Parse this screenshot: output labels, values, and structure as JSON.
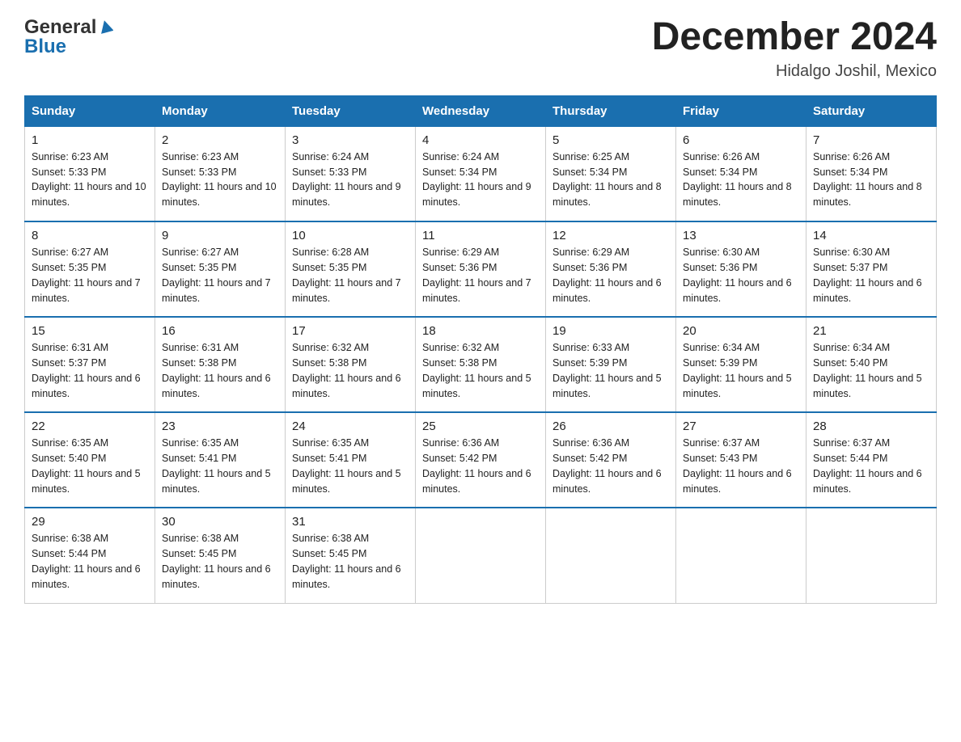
{
  "header": {
    "logo_general": "General",
    "logo_blue": "Blue",
    "main_title": "December 2024",
    "subtitle": "Hidalgo Joshil, Mexico"
  },
  "columns": [
    "Sunday",
    "Monday",
    "Tuesday",
    "Wednesday",
    "Thursday",
    "Friday",
    "Saturday"
  ],
  "weeks": [
    [
      {
        "day": "1",
        "sunrise": "Sunrise: 6:23 AM",
        "sunset": "Sunset: 5:33 PM",
        "daylight": "Daylight: 11 hours and 10 minutes."
      },
      {
        "day": "2",
        "sunrise": "Sunrise: 6:23 AM",
        "sunset": "Sunset: 5:33 PM",
        "daylight": "Daylight: 11 hours and 10 minutes."
      },
      {
        "day": "3",
        "sunrise": "Sunrise: 6:24 AM",
        "sunset": "Sunset: 5:33 PM",
        "daylight": "Daylight: 11 hours and 9 minutes."
      },
      {
        "day": "4",
        "sunrise": "Sunrise: 6:24 AM",
        "sunset": "Sunset: 5:34 PM",
        "daylight": "Daylight: 11 hours and 9 minutes."
      },
      {
        "day": "5",
        "sunrise": "Sunrise: 6:25 AM",
        "sunset": "Sunset: 5:34 PM",
        "daylight": "Daylight: 11 hours and 8 minutes."
      },
      {
        "day": "6",
        "sunrise": "Sunrise: 6:26 AM",
        "sunset": "Sunset: 5:34 PM",
        "daylight": "Daylight: 11 hours and 8 minutes."
      },
      {
        "day": "7",
        "sunrise": "Sunrise: 6:26 AM",
        "sunset": "Sunset: 5:34 PM",
        "daylight": "Daylight: 11 hours and 8 minutes."
      }
    ],
    [
      {
        "day": "8",
        "sunrise": "Sunrise: 6:27 AM",
        "sunset": "Sunset: 5:35 PM",
        "daylight": "Daylight: 11 hours and 7 minutes."
      },
      {
        "day": "9",
        "sunrise": "Sunrise: 6:27 AM",
        "sunset": "Sunset: 5:35 PM",
        "daylight": "Daylight: 11 hours and 7 minutes."
      },
      {
        "day": "10",
        "sunrise": "Sunrise: 6:28 AM",
        "sunset": "Sunset: 5:35 PM",
        "daylight": "Daylight: 11 hours and 7 minutes."
      },
      {
        "day": "11",
        "sunrise": "Sunrise: 6:29 AM",
        "sunset": "Sunset: 5:36 PM",
        "daylight": "Daylight: 11 hours and 7 minutes."
      },
      {
        "day": "12",
        "sunrise": "Sunrise: 6:29 AM",
        "sunset": "Sunset: 5:36 PM",
        "daylight": "Daylight: 11 hours and 6 minutes."
      },
      {
        "day": "13",
        "sunrise": "Sunrise: 6:30 AM",
        "sunset": "Sunset: 5:36 PM",
        "daylight": "Daylight: 11 hours and 6 minutes."
      },
      {
        "day": "14",
        "sunrise": "Sunrise: 6:30 AM",
        "sunset": "Sunset: 5:37 PM",
        "daylight": "Daylight: 11 hours and 6 minutes."
      }
    ],
    [
      {
        "day": "15",
        "sunrise": "Sunrise: 6:31 AM",
        "sunset": "Sunset: 5:37 PM",
        "daylight": "Daylight: 11 hours and 6 minutes."
      },
      {
        "day": "16",
        "sunrise": "Sunrise: 6:31 AM",
        "sunset": "Sunset: 5:38 PM",
        "daylight": "Daylight: 11 hours and 6 minutes."
      },
      {
        "day": "17",
        "sunrise": "Sunrise: 6:32 AM",
        "sunset": "Sunset: 5:38 PM",
        "daylight": "Daylight: 11 hours and 6 minutes."
      },
      {
        "day": "18",
        "sunrise": "Sunrise: 6:32 AM",
        "sunset": "Sunset: 5:38 PM",
        "daylight": "Daylight: 11 hours and 5 minutes."
      },
      {
        "day": "19",
        "sunrise": "Sunrise: 6:33 AM",
        "sunset": "Sunset: 5:39 PM",
        "daylight": "Daylight: 11 hours and 5 minutes."
      },
      {
        "day": "20",
        "sunrise": "Sunrise: 6:34 AM",
        "sunset": "Sunset: 5:39 PM",
        "daylight": "Daylight: 11 hours and 5 minutes."
      },
      {
        "day": "21",
        "sunrise": "Sunrise: 6:34 AM",
        "sunset": "Sunset: 5:40 PM",
        "daylight": "Daylight: 11 hours and 5 minutes."
      }
    ],
    [
      {
        "day": "22",
        "sunrise": "Sunrise: 6:35 AM",
        "sunset": "Sunset: 5:40 PM",
        "daylight": "Daylight: 11 hours and 5 minutes."
      },
      {
        "day": "23",
        "sunrise": "Sunrise: 6:35 AM",
        "sunset": "Sunset: 5:41 PM",
        "daylight": "Daylight: 11 hours and 5 minutes."
      },
      {
        "day": "24",
        "sunrise": "Sunrise: 6:35 AM",
        "sunset": "Sunset: 5:41 PM",
        "daylight": "Daylight: 11 hours and 5 minutes."
      },
      {
        "day": "25",
        "sunrise": "Sunrise: 6:36 AM",
        "sunset": "Sunset: 5:42 PM",
        "daylight": "Daylight: 11 hours and 6 minutes."
      },
      {
        "day": "26",
        "sunrise": "Sunrise: 6:36 AM",
        "sunset": "Sunset: 5:42 PM",
        "daylight": "Daylight: 11 hours and 6 minutes."
      },
      {
        "day": "27",
        "sunrise": "Sunrise: 6:37 AM",
        "sunset": "Sunset: 5:43 PM",
        "daylight": "Daylight: 11 hours and 6 minutes."
      },
      {
        "day": "28",
        "sunrise": "Sunrise: 6:37 AM",
        "sunset": "Sunset: 5:44 PM",
        "daylight": "Daylight: 11 hours and 6 minutes."
      }
    ],
    [
      {
        "day": "29",
        "sunrise": "Sunrise: 6:38 AM",
        "sunset": "Sunset: 5:44 PM",
        "daylight": "Daylight: 11 hours and 6 minutes."
      },
      {
        "day": "30",
        "sunrise": "Sunrise: 6:38 AM",
        "sunset": "Sunset: 5:45 PM",
        "daylight": "Daylight: 11 hours and 6 minutes."
      },
      {
        "day": "31",
        "sunrise": "Sunrise: 6:38 AM",
        "sunset": "Sunset: 5:45 PM",
        "daylight": "Daylight: 11 hours and 6 minutes."
      },
      null,
      null,
      null,
      null
    ]
  ]
}
